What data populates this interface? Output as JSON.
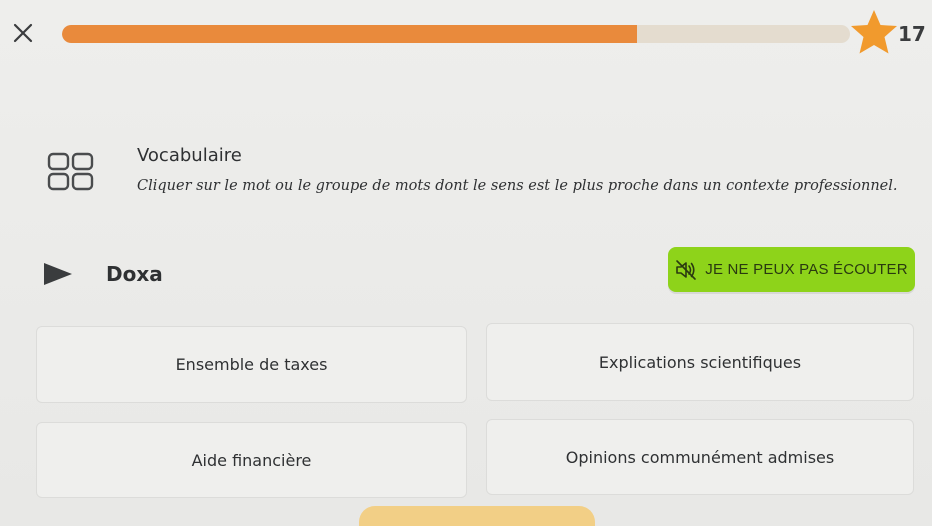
{
  "header": {
    "close_icon": "close-icon",
    "progress_fraction": 0.73,
    "progress_color": "#e98a3c",
    "star_icon": "star-icon",
    "star_color": "#f19a2d",
    "score": "17 /"
  },
  "section": {
    "icon": "grid-squares-icon",
    "title": "Vocabulaire",
    "instructions": "Cliquer sur le mot ou le groupe de mots dont le sens est le plus proche dans un contexte professionnel."
  },
  "question": {
    "play_icon": "play-icon",
    "word": "Doxa",
    "cant_listen_label": "JE NE PEUX PAS ÉCOUTER",
    "cant_listen_icon": "speaker-muted-icon",
    "cant_listen_color": "#8ed31a"
  },
  "options": [
    {
      "label": "Ensemble de taxes"
    },
    {
      "label": "Explications scientifiques"
    },
    {
      "label": "Aide financière"
    },
    {
      "label": "Opinions communément admises"
    }
  ],
  "footer": {
    "button_color": "#f2cf86"
  }
}
